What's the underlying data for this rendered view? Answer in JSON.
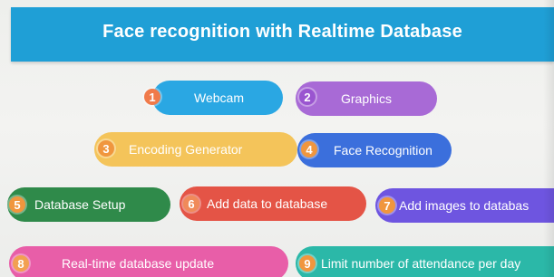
{
  "header": {
    "title": "Face recognition with Realtime Database"
  },
  "steps": [
    {
      "number": "1",
      "label": "Webcam",
      "color": "#2aa7e3",
      "badge_color": "#f07a4a"
    },
    {
      "number": "2",
      "label": "Graphics",
      "color": "#a86ad6",
      "badge_color": "#9a55d0"
    },
    {
      "number": "3",
      "label": "Encoding Generator",
      "color": "#f4c45a",
      "badge_color": "#f0963e"
    },
    {
      "number": "4",
      "label": "Face Recognition",
      "color": "#3b6fdc",
      "badge_color": "#f0963e"
    },
    {
      "number": "5",
      "label": "Database Setup",
      "color": "#2f8a4a",
      "badge_color": "#f0963e"
    },
    {
      "number": "6",
      "label": "Add data to database",
      "color": "#e45446",
      "badge_color": "#f08a5a"
    },
    {
      "number": "7",
      "label": "Add images to databas",
      "color": "#6e55e0",
      "badge_color": "#f0963e"
    },
    {
      "number": "8",
      "label": "Real-time database update",
      "color": "#e85ea8",
      "badge_color": "#f2a052"
    },
    {
      "number": "9",
      "label": "Limit number of attendance per day",
      "color": "#2bb8a8",
      "badge_color": "#f0963e"
    }
  ]
}
